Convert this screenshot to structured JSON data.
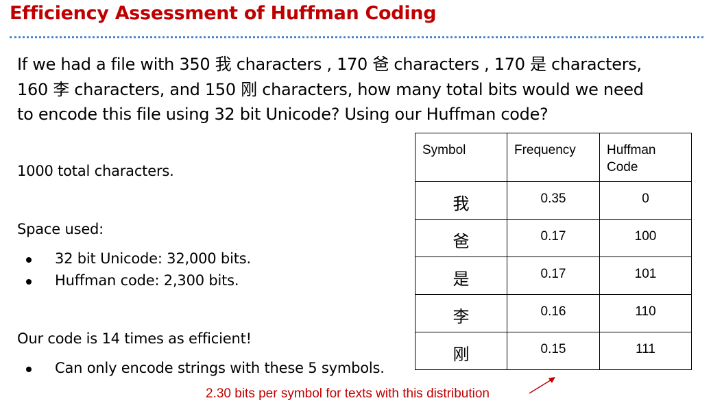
{
  "slide": {
    "title": "Efficiency Assessment of Huffman Coding",
    "question_lines": [
      "If we had a file with 350 我 characters , 170 爸 characters , 170 是 characters,",
      "160 李 characters, and 150 刚 characters, how many total bits would we need",
      "to encode this file using 32 bit Unicode? Using our Huffman code?"
    ],
    "total": "1000 total characters.",
    "space_heading": "Space used:",
    "space_items": [
      "32 bit Unicode: 32,000 bits.",
      "Huffman code: 2,300 bits."
    ],
    "efficiency": "Our code is 14 times as efficient!",
    "caveat": "Can only encode strings with these 5 symbols.",
    "note": "2.30 bits per symbol for texts with this distribution",
    "accent_color": "#c00000",
    "rule_color": "#4a86c8"
  },
  "table": {
    "headers": [
      "Symbol",
      "Frequency",
      "Huffman Code"
    ],
    "rows": [
      {
        "symbol": "我",
        "frequency": "0.35",
        "code": "0"
      },
      {
        "symbol": "爸",
        "frequency": "0.17",
        "code": "100"
      },
      {
        "symbol": "是",
        "frequency": "0.17",
        "code": "101"
      },
      {
        "symbol": "李",
        "frequency": "0.16",
        "code": "110"
      },
      {
        "symbol": "刚",
        "frequency": "0.15",
        "code": "111"
      }
    ]
  }
}
